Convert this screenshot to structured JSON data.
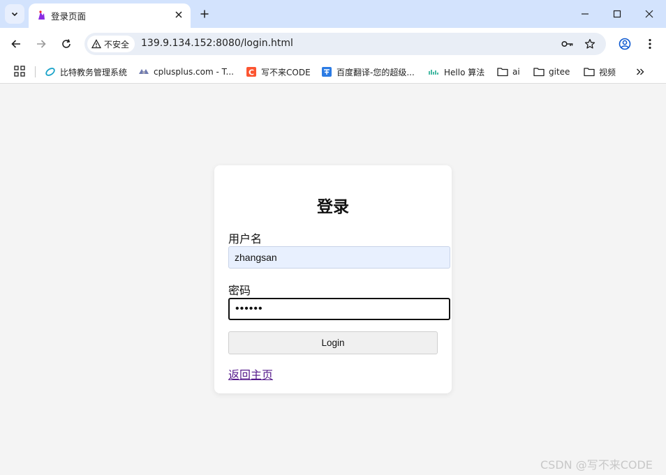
{
  "colors": {
    "tabstrip": "#d3e3fd",
    "toolbar": "#ffffff",
    "page_bg": "#f4f4f4",
    "autofill_bg": "#e8f0fe",
    "visited_link": "#551a8b"
  },
  "tab": {
    "title": "登录页面",
    "favicon": "tab-favicon-icon"
  },
  "omnibox": {
    "security_label": "不安全",
    "url": "139.9.134.152:8080/login.html"
  },
  "bookmarks": [
    {
      "label": "比特教务管理系统",
      "icon": "bit-logo-icon"
    },
    {
      "label": "cplusplus.com - T...",
      "icon": "cplusplus-icon"
    },
    {
      "label": "写不来CODE",
      "icon": "csdn-icon"
    },
    {
      "label": "百度翻译-您的超级...",
      "icon": "translate-icon"
    },
    {
      "label": "Hello 算法",
      "icon": "hello-algo-icon"
    },
    {
      "label": "ai",
      "icon": "folder-icon"
    },
    {
      "label": "gitee",
      "icon": "folder-icon"
    },
    {
      "label": "视频",
      "icon": "folder-icon"
    }
  ],
  "login": {
    "title": "登录",
    "username_label": "用户名",
    "username_value": "zhangsan",
    "password_label": "密码",
    "password_value": "••••••",
    "submit_label": "Login",
    "home_link": "返回主页"
  },
  "watermark": "CSDN @写不来CODE"
}
